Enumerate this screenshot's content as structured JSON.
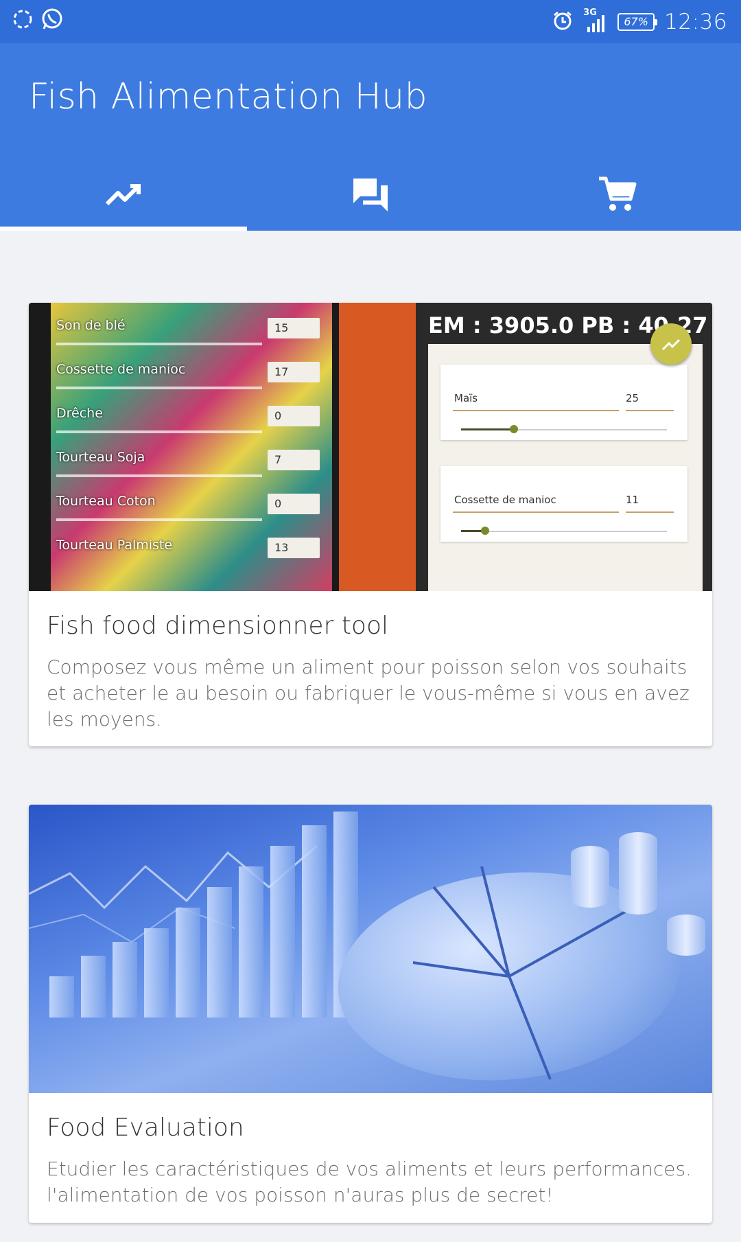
{
  "status_bar": {
    "time": "12:36",
    "battery": "67%",
    "network": "3G",
    "icons": [
      "sync-icon",
      "whatsapp-icon",
      "alarm-icon",
      "signal-icon",
      "battery-icon"
    ]
  },
  "app_bar": {
    "title": "Fish Alimentation Hub",
    "background": "#3d7be0"
  },
  "tabs": [
    {
      "icon": "trending-up-icon",
      "selected": true
    },
    {
      "icon": "forum-icon",
      "selected": false
    },
    {
      "icon": "shopping-cart-icon",
      "selected": false
    }
  ],
  "cards": [
    {
      "title": "Fish food dimensionner tool",
      "text": "Composez vous même un aliment pour poisson selon vos souhaits et acheter le au besoin ou fabriquer le vous-même si vous en avez les moyens.",
      "media": {
        "left_rows": [
          {
            "label": "Son de blé",
            "value": "15"
          },
          {
            "label": "Cossette de manioc",
            "value": "17"
          },
          {
            "label": "Drêche",
            "value": "0"
          },
          {
            "label": "Tourteau Soja",
            "value": "7"
          },
          {
            "label": "Tourteau Coton",
            "value": "0"
          },
          {
            "label": "Tourteau Palmiste",
            "value": "13"
          }
        ],
        "header": "EM : 3905.0  PB : 40.27",
        "panels": [
          {
            "label": "Maïs",
            "value": "25",
            "level": 0.25
          },
          {
            "label": "Cossette de manioc",
            "value": "11",
            "level": 0.11
          }
        ]
      }
    },
    {
      "title": "Food Evaluation",
      "text": "Etudier les caractéristiques de vos aliments et leurs performances. l'alimentation de vos poisson n'auras plus de secret!"
    }
  ]
}
